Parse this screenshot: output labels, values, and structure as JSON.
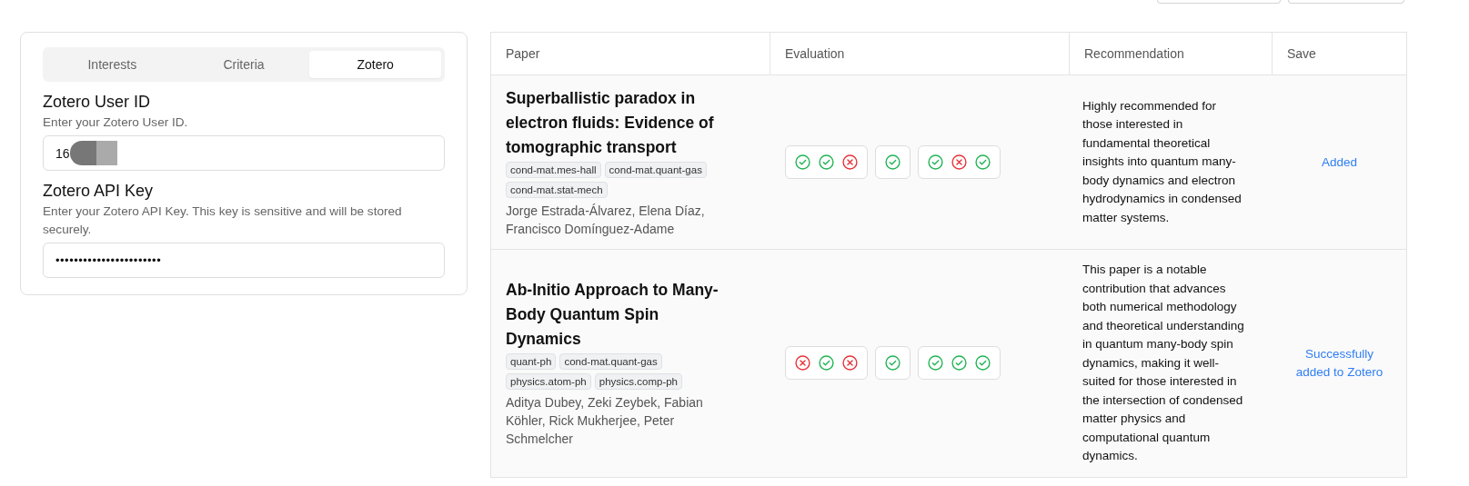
{
  "tabs": [
    {
      "label": "Interests",
      "selected": false
    },
    {
      "label": "Criteria",
      "selected": false
    },
    {
      "label": "Zotero",
      "selected": true
    }
  ],
  "fields": [
    {
      "label": "Zotero User ID",
      "hint": "Enter your Zotero User ID.",
      "value": "16",
      "redacted": true,
      "kind": "text"
    },
    {
      "label": "Zotero API Key",
      "hint": "Enter your Zotero API Key. This key is sensitive and will be stored securely.",
      "value": "•••••••••••••••••••••••",
      "redacted": false,
      "kind": "password"
    }
  ],
  "table": {
    "columns": [
      "Paper",
      "Evaluation",
      "Recommendation",
      "Save"
    ],
    "rows": [
      {
        "title": "Superballistic paradox in electron fluids: Evidence of tomographic transport",
        "tags": [
          "cond-mat.mes-hall",
          "cond-mat.quant-gas",
          "cond-mat.stat-mech"
        ],
        "authors": "Jorge Estrada-Álvarez, Elena Díaz, Francisco Domínguez-Adame",
        "evaluation": [
          [
            true,
            true,
            false
          ],
          [
            true
          ],
          [
            true,
            false,
            true
          ]
        ],
        "recommendation": "Highly recommended for those interested in fundamental theoretical insights into quantum many-body dynamics and electron hydrodynamics in condensed matter systems.",
        "save": "Added"
      },
      {
        "title": "Ab-Initio Approach to Many-Body Quantum Spin Dynamics",
        "tags": [
          "quant-ph",
          "cond-mat.quant-gas",
          "physics.atom-ph",
          "physics.comp-ph"
        ],
        "authors": "Aditya Dubey, Zeki Zeybek, Fabian Köhler, Rick Mukherjee, Peter Schmelcher",
        "evaluation": [
          [
            false,
            true,
            false
          ],
          [
            true
          ],
          [
            true,
            true,
            true
          ]
        ],
        "recommendation": "This paper is a notable contribution that advances both numerical methodology and theoretical understanding in quantum many-body spin dynamics, making it well-suited for those interested in the intersection of condensed matter physics and computational quantum dynamics.",
        "save": "Successfully added to Zotero"
      }
    ]
  }
}
